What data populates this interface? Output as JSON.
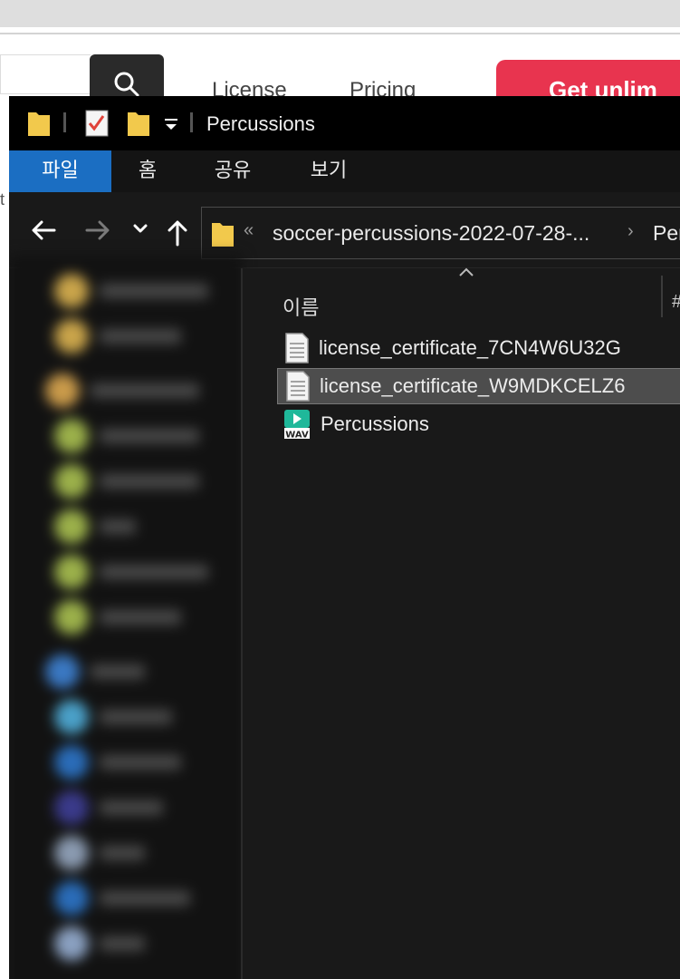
{
  "website": {
    "nav": [
      "License",
      "Pricing"
    ],
    "cta": "Get unlim",
    "edge_char": "t"
  },
  "explorer": {
    "title": "Percussions",
    "ribbon_tabs": [
      "파일",
      "홈",
      "공유",
      "보기"
    ],
    "address": {
      "overflow": "«",
      "segments": [
        "soccer-percussions-2022-07-28-...",
        "Per"
      ],
      "separator": "›"
    },
    "columns": {
      "name": "이름",
      "next": "#"
    },
    "files": [
      {
        "name": "license_certificate_7CN4W6U32G",
        "icon": "text-file-icon",
        "selected": false
      },
      {
        "name": "license_certificate_W9MDKCELZ6",
        "icon": "text-file-icon",
        "selected": true
      },
      {
        "name": "Percussions",
        "icon": "wav-audio-icon",
        "badge": "WAV",
        "selected": false
      }
    ]
  },
  "colors": {
    "file_tab": "#1b6ec2",
    "cta": "#e8344f",
    "folder": "#f2c94c",
    "wav": "#1fb89a"
  }
}
